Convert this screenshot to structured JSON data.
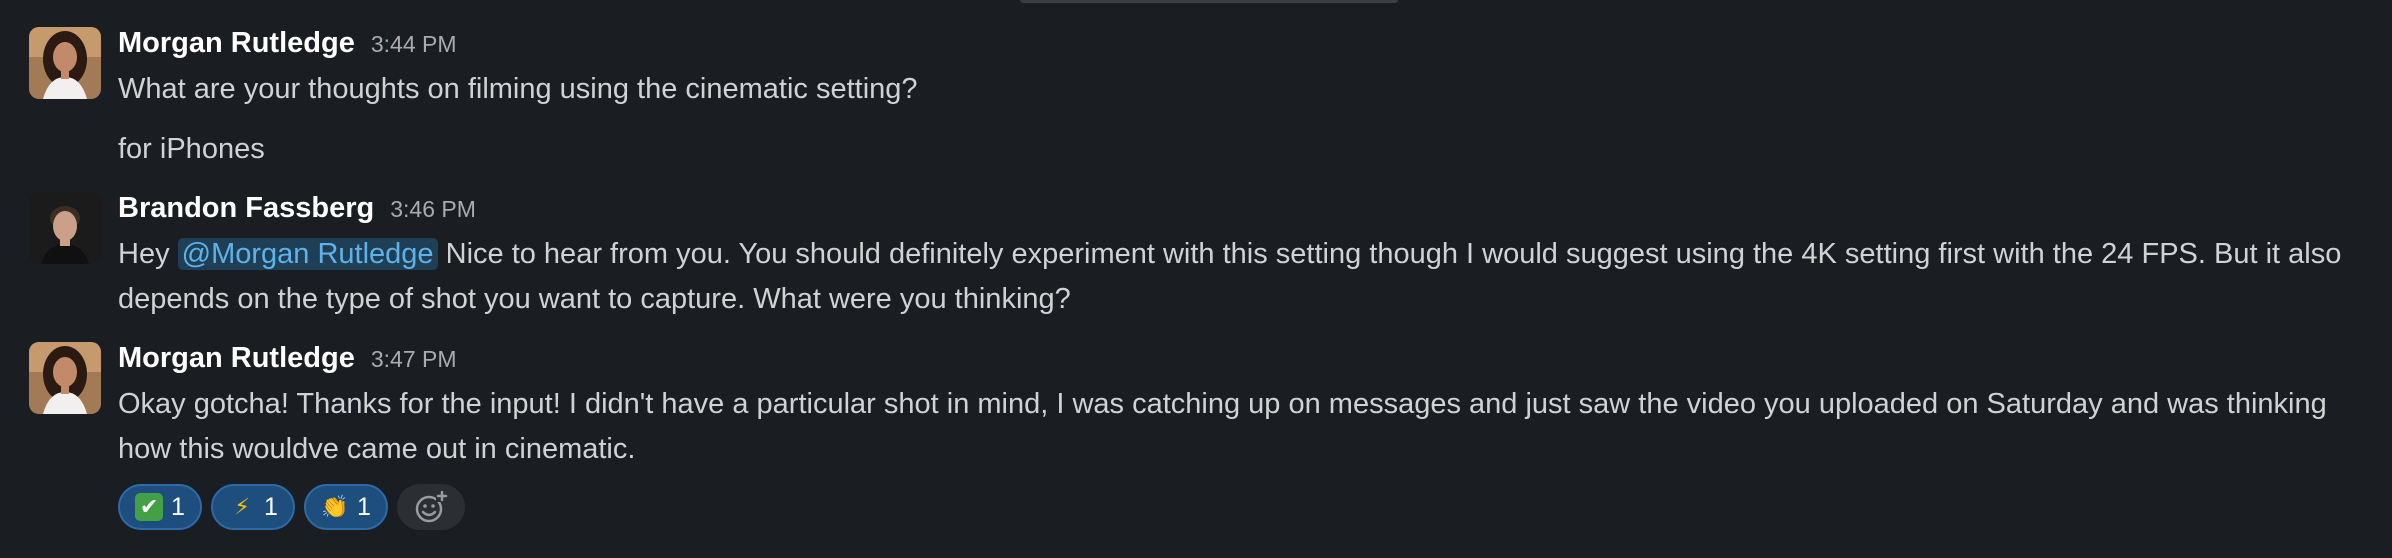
{
  "messages": [
    {
      "author": "Morgan Rutledge",
      "time": "3:44 PM",
      "text": "What are your thoughts on filming using the cinematic setting?",
      "followup": "for iPhones"
    },
    {
      "author": "Brandon Fassberg",
      "time": "3:46 PM",
      "mention": "@Morgan Rutledge",
      "text_after_mention": " Nice to hear from you. You should definitely experiment with this setting though I would suggest using the 4K setting first with the 24 FPS. But it also depends on the type of shot you want to capture. What were you thinking?",
      "text_before_mention": "Hey "
    },
    {
      "author": "Morgan Rutledge",
      "time": "3:47 PM",
      "text": "Okay gotcha! Thanks for the input! I didn't have a particular shot in mind, I was catching up on messages and just saw the video you uploaded on Saturday and was thinking how this wouldve came out in cinematic.",
      "reactions": [
        {
          "emoji": "white-check-mark",
          "glyph": "✔",
          "count": "1"
        },
        {
          "emoji": "zap",
          "glyph": "⚡",
          "count": "1"
        },
        {
          "emoji": "clap",
          "glyph": "👏",
          "count": "1"
        }
      ],
      "add_reaction_icon": "add-reaction-icon"
    }
  ],
  "colors": {
    "background": "#1a1d21",
    "mention_bg": "#1f3f57",
    "mention_text": "#5eb2e8",
    "reaction_bg": "#1d4e7d"
  }
}
